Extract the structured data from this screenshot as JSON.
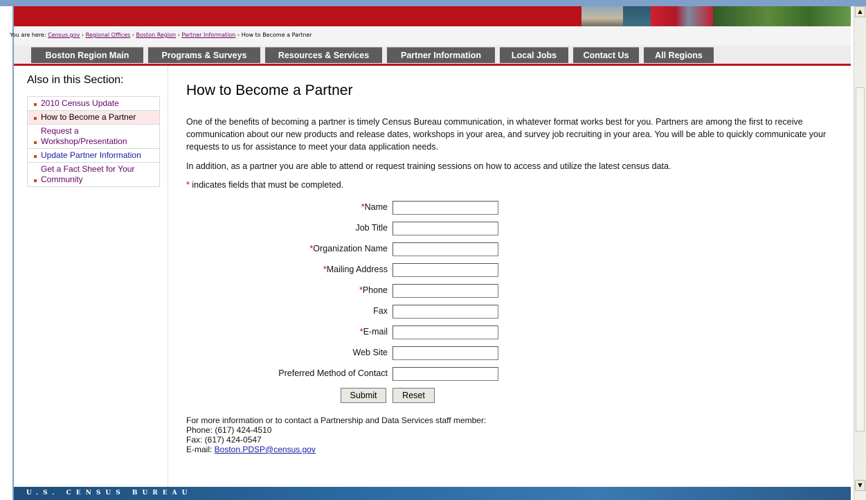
{
  "breadcrumb": {
    "prefix": "You are here:",
    "items": [
      "Census.gov",
      "Regional Offices",
      "Boston Region",
      "Partner Information"
    ],
    "separator": "›",
    "current": "How to Become a Partner"
  },
  "nav": {
    "tabs": [
      "Boston Region Main",
      "Programs & Surveys",
      "Resources & Services",
      "Partner Information",
      "Local Jobs",
      "Contact Us",
      "All Regions"
    ]
  },
  "sidebar": {
    "title": "Also in this Section:",
    "items": [
      {
        "label": "2010 Census Update"
      },
      {
        "label": "How to Become a Partner"
      },
      {
        "label": "Request a Workshop/Presentation"
      },
      {
        "label": "Update Partner Information"
      },
      {
        "label": "Get a Fact Sheet for Your Community"
      }
    ]
  },
  "main": {
    "title": "How to Become a Partner",
    "intro": "One of the benefits of becoming a partner is timely Census Bureau communication, in whatever format works best for you. Partners are among the first to receive communication about our new products and release dates, workshops in your area, and survey job recruiting in your area. You will be able to quickly communicate your requests to us for assistance to meet your data application needs.",
    "training": "In addition, as a partner you are able to attend or request training sessions on how to access and utilize the latest census data.",
    "required_marker": "*",
    "required_note": " indicates fields that must be completed."
  },
  "form": {
    "fields": [
      {
        "label": "Name",
        "required": "*",
        "value": ""
      },
      {
        "label": "Job Title",
        "required": "",
        "value": ""
      },
      {
        "label": "Organization Name",
        "required": "*",
        "value": ""
      },
      {
        "label": "Mailing Address",
        "required": "*",
        "value": ""
      },
      {
        "label": "Phone",
        "required": "*",
        "value": ""
      },
      {
        "label": "Fax",
        "required": "",
        "value": ""
      },
      {
        "label": "E-mail",
        "required": "*",
        "value": ""
      },
      {
        "label": "Web Site",
        "required": "",
        "value": ""
      },
      {
        "label": "Preferred Method of Contact",
        "required": "",
        "value": ""
      }
    ],
    "submit_label": "Submit",
    "reset_label": "Reset"
  },
  "contact": {
    "intro": "For more information or to contact a Partnership and Data Services staff member:",
    "phone": "Phone: (617) 424-4510",
    "fax": "Fax: (617) 424-0547",
    "email_prefix": "E-mail: ",
    "email": "Boston.PDSP@census.gov"
  },
  "footer": {
    "text": "U.S. CENSUS BUREAU"
  },
  "colors": {
    "banner_red": "#b8111a",
    "nav_tab": "#5c5c5c",
    "nav_rule": "#c0141c",
    "visited_link": "#660066",
    "link": "#1a1aa6",
    "required": "#cc0000"
  },
  "icons": {
    "scroll_up": "scroll-up-arrow-icon",
    "scroll_down": "scroll-down-arrow-icon",
    "bullet": "square-bullet-icon"
  }
}
